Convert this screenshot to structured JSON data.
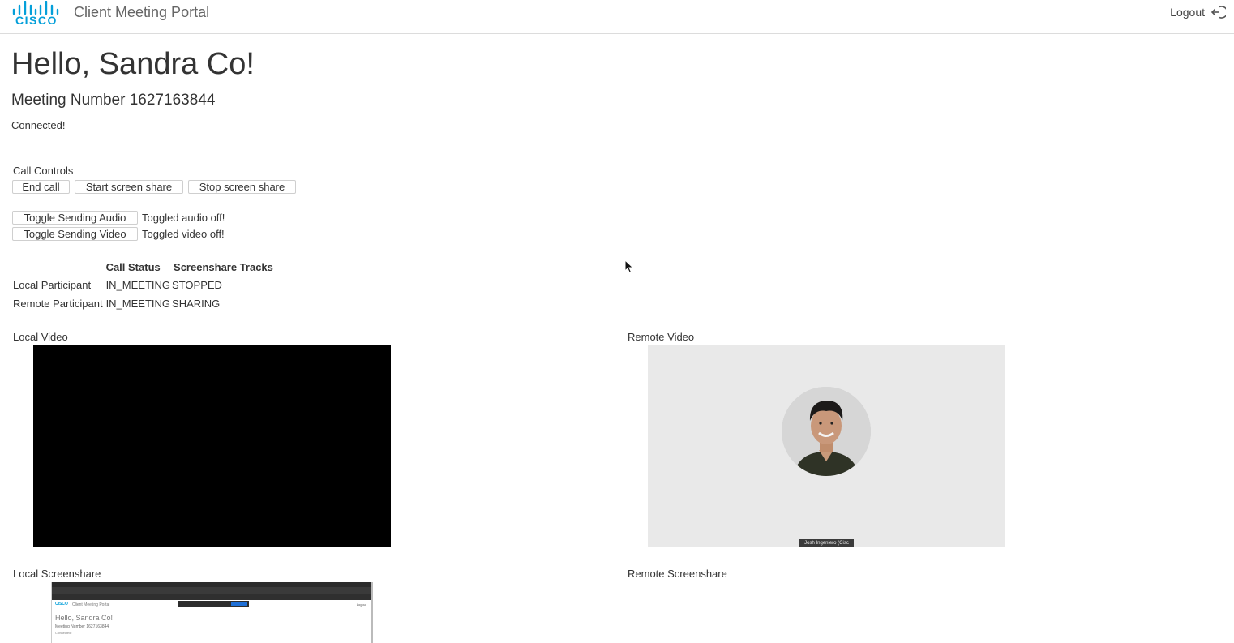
{
  "header": {
    "logo_text": "CISCO",
    "app_title": "Client Meeting Portal",
    "logout_label": "Logout",
    "logout_icon": "logout-icon",
    "brand_color": "#049fd9"
  },
  "main": {
    "greeting": "Hello, Sandra Co!",
    "meeting_number": "Meeting Number 1627163844",
    "connection_status": "Connected!"
  },
  "call_controls": {
    "label": "Call Controls",
    "end_call": "End call",
    "start_screen_share": "Start screen share",
    "stop_screen_share": "Stop screen share",
    "toggle_audio": "Toggle Sending Audio",
    "audio_status": "Toggled audio off!",
    "toggle_video": "Toggle Sending Video",
    "video_status": "Toggled video off!"
  },
  "status_table": {
    "headers": [
      "",
      "Call Status",
      "Screenshare Tracks"
    ],
    "rows": [
      {
        "participant": "Local Participant",
        "call_status": "IN_MEETING",
        "screenshare": "STOPPED"
      },
      {
        "participant": "Remote Participant",
        "call_status": "IN_MEETING",
        "screenshare": "SHARING"
      }
    ]
  },
  "videos": {
    "local_video_label": "Local Video",
    "remote_video_label": "Remote Video",
    "remote_participant_name": "Josh Ingeniero (Cisc",
    "local_screenshare_label": "Local Screenshare",
    "remote_screenshare_label": "Remote Screenshare"
  },
  "local_screenshare_preview": {
    "logo_text": "CISCO",
    "app_title": "Client Meeting Portal",
    "logout_label": "Logout",
    "greeting": "Hello, Sandra Co!",
    "meeting_number": "Meeting Number 1627163844",
    "connection_status": "Connected!"
  }
}
